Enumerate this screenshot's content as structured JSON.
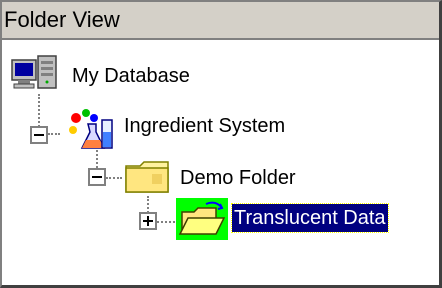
{
  "panel": {
    "title": "Folder View"
  },
  "tree": {
    "nodes": [
      {
        "label": "My Database",
        "icon": "database-computer-icon",
        "expanded": true
      },
      {
        "label": "Ingredient System",
        "icon": "chemistry-flask-icon",
        "expanded": true
      },
      {
        "label": "Demo Folder",
        "icon": "folder-icon",
        "expanded": true
      },
      {
        "label": "Translucent Data",
        "icon": "open-folder-icon",
        "expanded": false,
        "selected": true
      }
    ]
  },
  "colors": {
    "selection_bg": "#000080",
    "header_bg": "#d4d0c8",
    "icon_highlight": "#00ff00"
  }
}
